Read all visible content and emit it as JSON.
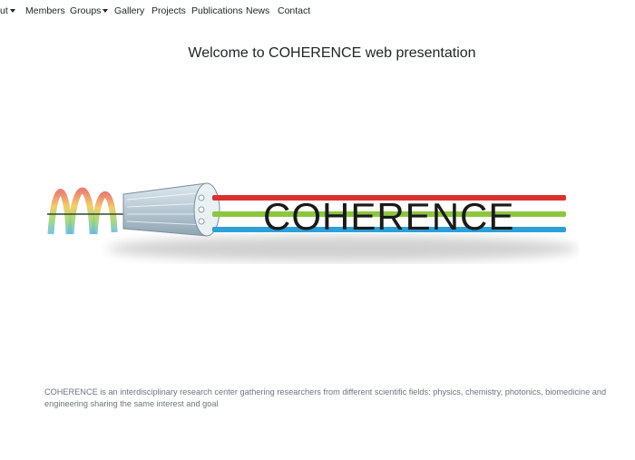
{
  "nav": {
    "about": "ut",
    "members": "Members",
    "groups": "Groups",
    "gallery": "Gallery",
    "projects": "Projects",
    "publications": "Publications",
    "news": "News",
    "contact": "Contact"
  },
  "page": {
    "title": "Welcome to COHERENCE web presentation"
  },
  "logo": {
    "wordmark": "COHERENCE",
    "colors": {
      "red": "#d9322e",
      "green": "#8cc63f",
      "blue": "#2d9fd9"
    }
  },
  "intro": {
    "text": "COHERENCE is an interdisciplinary research center gathering researchers from different scientific fields: physics, chemistry, photonics, biomedicine and engineering sharing the same interest and goal"
  }
}
